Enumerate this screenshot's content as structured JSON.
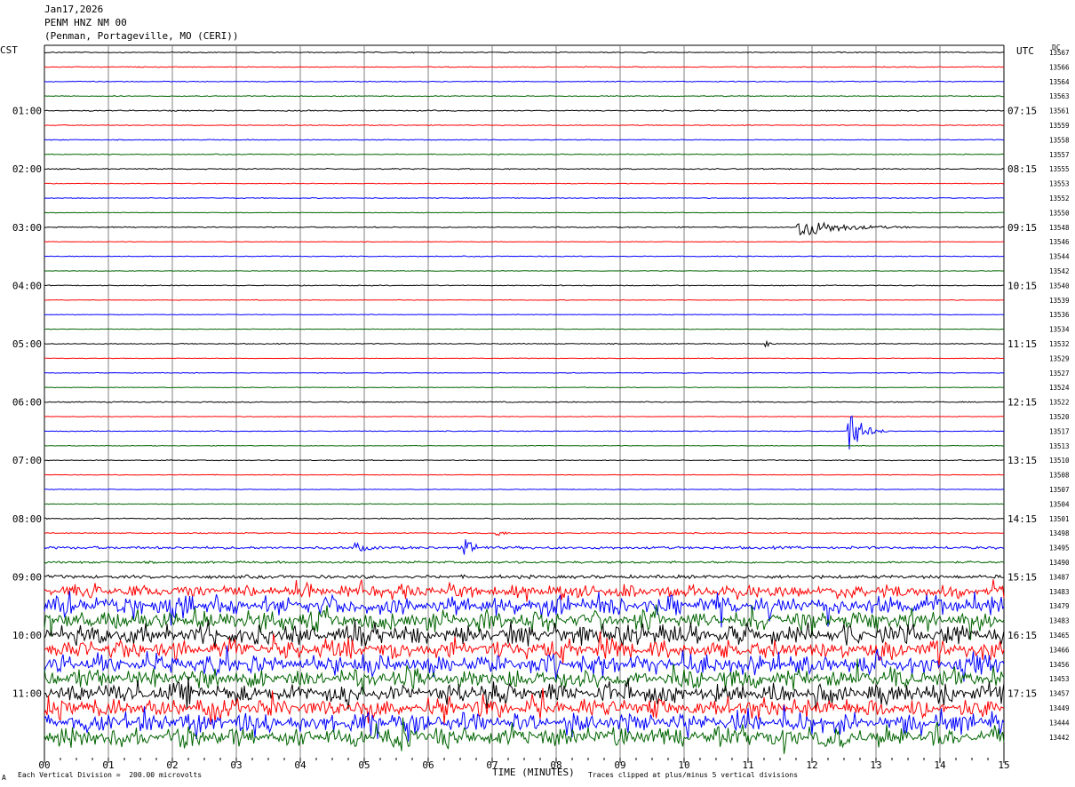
{
  "header": {
    "date": "Jan17,2026",
    "station": "PENM HNZ NM 00",
    "location": "(Penman, Portageville, MO (CERI))"
  },
  "left_tz": "CST",
  "right_tz": "UTC",
  "dc_label": "DC",
  "footer": {
    "left_mark": "A",
    "scale_note": "Each Vertical Division =  200.00 microvolts",
    "xlabel": "TIME (MINUTES)",
    "clip_note": "Traces clipped at plus/minus 5 vertical divisions"
  },
  "chart_data": {
    "type": "line",
    "title": "PENM HNZ NM 00",
    "xlabel": "TIME (MINUTES)",
    "ylabel": "",
    "xlim": [
      0,
      15
    ],
    "x_ticks": [
      "00",
      "01",
      "02",
      "03",
      "04",
      "05",
      "06",
      "07",
      "08",
      "09",
      "10",
      "11",
      "12",
      "13",
      "14",
      "15"
    ],
    "trace_colors": [
      "#000000",
      "#ff0000",
      "#0000ff",
      "#006400"
    ],
    "left_hour_labels": [
      "01:00",
      "02:00",
      "03:00",
      "04:00",
      "05:00",
      "06:00",
      "07:00",
      "08:00",
      "09:00",
      "10:00",
      "11:00"
    ],
    "right_hour_labels": [
      "07:15",
      "08:15",
      "09:15",
      "10:15",
      "11:15",
      "12:15",
      "13:15",
      "14:15",
      "15:15",
      "16:15",
      "17:15"
    ],
    "dc_offsets": [
      13567,
      13566,
      13564,
      13563,
      13561,
      13559,
      13558,
      13557,
      13555,
      13553,
      13552,
      13550,
      13548,
      13546,
      13544,
      13542,
      13540,
      13539,
      13536,
      13534,
      13532,
      13529,
      13527,
      13524,
      13522,
      13520,
      13517,
      13513,
      13510,
      13508,
      13507,
      13504,
      13501,
      13498,
      13495,
      13490,
      13487,
      13483,
      13479,
      13483,
      13465,
      13466,
      13456,
      13453,
      13457,
      13449,
      13444,
      13442
    ],
    "trace_noise_level": [
      0.5,
      0.4,
      0.4,
      0.4,
      0.5,
      0.4,
      0.4,
      0.4,
      0.5,
      0.3,
      0.4,
      0.3,
      0.5,
      0.3,
      0.4,
      0.3,
      0.4,
      0.3,
      0.3,
      0.3,
      0.4,
      0.3,
      0.3,
      0.3,
      0.5,
      0.3,
      0.4,
      0.3,
      0.4,
      0.3,
      0.3,
      0.3,
      0.5,
      0.5,
      1.2,
      1.0,
      1.5,
      4,
      6,
      6,
      6,
      6,
      6,
      6,
      6,
      6,
      6,
      6
    ],
    "events": [
      {
        "trace": 12,
        "minute": 11.8,
        "amplitude": 12,
        "duration": 1.8
      },
      {
        "trace": 26,
        "minute": 12.6,
        "amplitude": 25,
        "duration": 0.6
      },
      {
        "trace": 34,
        "minute": 6.6,
        "amplitude": 8,
        "duration": 0.5
      },
      {
        "trace": 34,
        "minute": 4.9,
        "amplitude": 5,
        "duration": 0.4
      },
      {
        "trace": 20,
        "minute": 11.3,
        "amplitude": 4,
        "duration": 0.2
      },
      {
        "trace": 33,
        "minute": 7.1,
        "amplitude": 3,
        "duration": 0.3
      }
    ]
  }
}
